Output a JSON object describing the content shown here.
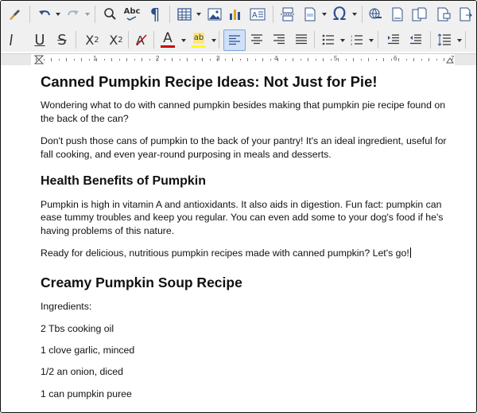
{
  "document": {
    "h1": "Canned Pumpkin Recipe Ideas: Not Just for Pie!",
    "p1_l1": "Wondering what to do with canned pumpkin besides making that pumpkin pie recipe found on",
    "p1_l2": "the back of the can?",
    "p2_l1": "Don't push those cans of pumpkin to the back of your pantry! It's an ideal ingredient, useful for",
    "p2_l2": "fall cooking, and even year-round purposing in meals and desserts.",
    "h2": "Health Benefits of Pumpkin",
    "p3_l1": "Pumpkin is high in vitamin A and antioxidants. It also aids in digestion. Fun fact: pumpkin can",
    "p3_l2": "ease tummy troubles and keep you regular. You can even add some to your dog's food if he's",
    "p3_l3": "having problems of this nature.",
    "p4": "Ready for delicious, nutritious pumpkin recipes made with canned pumpkin? Let's go!",
    "h3": "Creamy Pumpkin Soup Recipe",
    "ingredients_label": "Ingredients:",
    "ingredients": [
      "2 Tbs cooking oil",
      "1 clove garlic, minced",
      "1/2 an onion, diced",
      "1 can pumpkin puree"
    ]
  },
  "toolbar": {
    "spelling_label": "Abc",
    "pilcrow": "¶",
    "omega": "Ω",
    "underline": "U",
    "strike": "S",
    "superscript_base": "X",
    "superscript_exp": "2",
    "subscript_base": "X",
    "subscript_exp": "2",
    "font_color": "A",
    "highlight": "ab",
    "icons": [
      "clone-formatting-icon",
      "undo-icon",
      "redo-icon",
      "find-replace-icon",
      "spelling-icon",
      "formatting-marks-icon",
      "table-icon",
      "image-icon",
      "chart-icon",
      "textbox-icon",
      "page-break-icon",
      "field-icon",
      "special-character-icon",
      "hyperlink-icon",
      "footnote-icon",
      "comment-icon",
      "track-changes-icon",
      "italic-icon",
      "underline-icon",
      "strikethrough-icon",
      "superscript-icon",
      "subscript-icon",
      "clear-formatting-icon",
      "font-color-icon",
      "highlight-icon",
      "align-left-icon",
      "align-center-icon",
      "align-right-icon",
      "justify-icon",
      "bullet-list-icon",
      "numbered-list-icon",
      "increase-indent-icon",
      "decrease-indent-icon",
      "line-spacing-icon"
    ]
  },
  "ruler": {
    "numbers": [
      "1",
      "2",
      "3",
      "4",
      "5",
      "6",
      "7"
    ]
  },
  "colors": {
    "font_color_bar": "#cc0000",
    "highlight_bar": "#ffff00",
    "accent": "#2c4f8a"
  }
}
